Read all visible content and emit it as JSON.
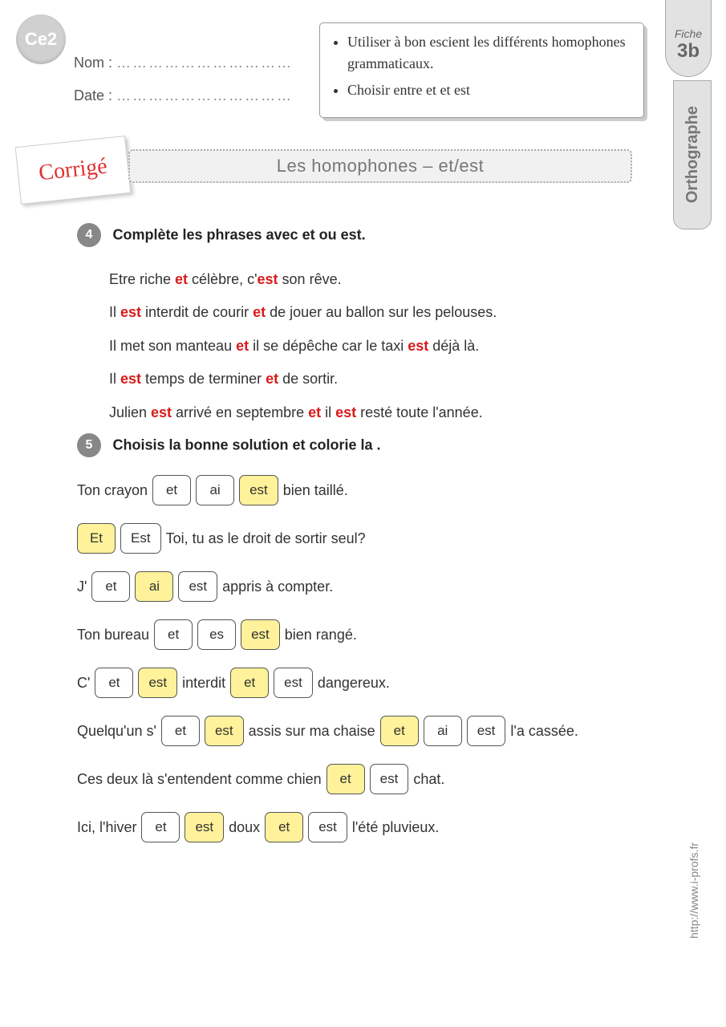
{
  "grade": "Ce2",
  "name_label": "Nom :",
  "date_label": "Date :",
  "dots": "……………………………",
  "objectives": [
    "Utiliser à bon escient les différents homophones grammaticaux.",
    "Choisir entre et et est"
  ],
  "fiche": {
    "label": "Fiche",
    "num": "3b"
  },
  "subject": "Orthographe",
  "corrige": "Corrigé",
  "title": "Les homophones – et/est",
  "ex4": {
    "num": "4",
    "instr": "Complète les phrases avec et ou est.",
    "lines": [
      [
        {
          "t": "Etre riche "
        },
        {
          "t": "et",
          "a": true
        },
        {
          "t": "  célèbre, c'"
        },
        {
          "t": "est",
          "a": true
        },
        {
          "t": " son rêve."
        }
      ],
      [
        {
          "t": " Il "
        },
        {
          "t": "est",
          "a": true
        },
        {
          "t": " interdit de courir "
        },
        {
          "t": "et",
          "a": true
        },
        {
          "t": " de jouer au ballon sur les pelouses."
        }
      ],
      [
        {
          "t": "Il met son manteau "
        },
        {
          "t": "et",
          "a": true
        },
        {
          "t": "  il se dépêche car le taxi "
        },
        {
          "t": "est",
          "a": true
        },
        {
          "t": " déjà là."
        }
      ],
      [
        {
          "t": "Il "
        },
        {
          "t": "est",
          "a": true
        },
        {
          "t": " temps de terminer "
        },
        {
          "t": "et",
          "a": true
        },
        {
          "t": " de sortir."
        }
      ],
      [
        {
          "t": "Julien "
        },
        {
          "t": "est",
          "a": true
        },
        {
          "t": " arrivé en septembre "
        },
        {
          "t": "et",
          "a": true
        },
        {
          "t": " il "
        },
        {
          "t": "est",
          "a": true
        },
        {
          "t": " resté toute l'année."
        }
      ]
    ]
  },
  "ex5": {
    "num": "5",
    "instr": "Choisis la bonne solution et colorie la .",
    "rows": [
      [
        {
          "txt": "Ton crayon"
        },
        {
          "opt": "et"
        },
        {
          "opt": "ai"
        },
        {
          "opt": "est",
          "sel": true
        },
        {
          "txt": " bien  taillé."
        }
      ],
      [
        {
          "opt": "Et",
          "sel": true
        },
        {
          "opt": "Est"
        },
        {
          "txt": " Toi, tu as le droit de sortir seul?"
        }
      ],
      [
        {
          "txt": "J' "
        },
        {
          "opt": "et"
        },
        {
          "opt": "ai",
          "sel": true
        },
        {
          "opt": "est"
        },
        {
          "txt": "appris à compter."
        }
      ],
      [
        {
          "txt": "Ton bureau"
        },
        {
          "opt": "et"
        },
        {
          "opt": "es"
        },
        {
          "opt": "est",
          "sel": true
        },
        {
          "txt": " bien rangé."
        }
      ],
      [
        {
          "txt": " C' "
        },
        {
          "opt": "et"
        },
        {
          "opt": "est",
          "sel": true
        },
        {
          "txt": " interdit "
        },
        {
          "opt": "et",
          "sel": true
        },
        {
          "opt": "est"
        },
        {
          "txt": " dangereux."
        }
      ],
      [
        {
          "txt": "Quelqu'un s' "
        },
        {
          "opt": "et"
        },
        {
          "opt": "est",
          "sel": true
        },
        {
          "txt": " assis sur ma chaise "
        },
        {
          "opt": "et",
          "sel": true
        },
        {
          "opt": "ai"
        },
        {
          "opt": "est"
        },
        {
          "txt": " l'a cassée."
        }
      ],
      [
        {
          "txt": "Ces deux là s'entendent comme chien "
        },
        {
          "opt": "et",
          "sel": true
        },
        {
          "opt": "est"
        },
        {
          "txt": " chat."
        }
      ],
      [
        {
          "txt": " Ici, l'hiver "
        },
        {
          "opt": "et"
        },
        {
          "opt": "est",
          "sel": true
        },
        {
          "txt": " doux "
        },
        {
          "opt": "et",
          "sel": true
        },
        {
          "opt": "est"
        },
        {
          "txt": " l'été pluvieux."
        }
      ]
    ]
  },
  "url": "http://www.i-profs.fr"
}
